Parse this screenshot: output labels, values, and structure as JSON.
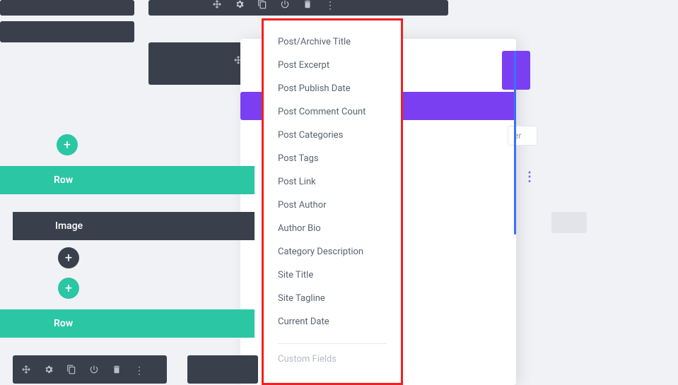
{
  "toolbar_top": {
    "move": "↔",
    "settings": "⚙",
    "duplicate": "⎘",
    "power": "⏻",
    "delete": "🗑",
    "more": "⋮"
  },
  "left": {
    "row1": "Row",
    "image": "Image",
    "row2": "Row"
  },
  "dropdown": {
    "items": [
      "Post/Archive Title",
      "Post Excerpt",
      "Post Publish Date",
      "Post Comment Count",
      "Post Categories",
      "Post Tags",
      "Post Link",
      "Post Author",
      "Author Bio",
      "Category Description",
      "Site Title",
      "Site Tagline",
      "Current Date"
    ],
    "footer": "Custom Fields"
  },
  "aux": {
    "text": "er"
  },
  "add_btn": "+"
}
